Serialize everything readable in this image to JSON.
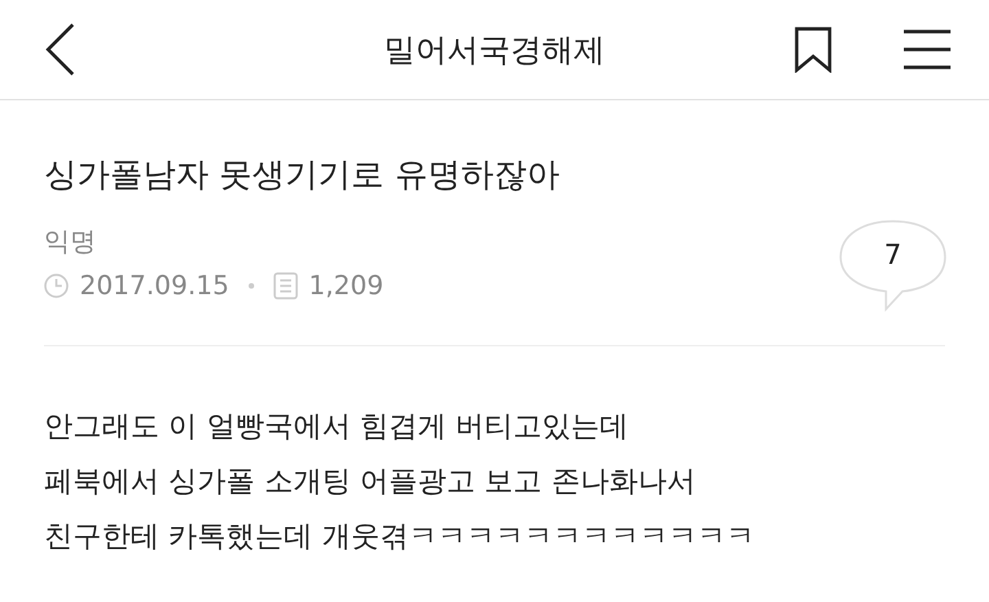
{
  "header": {
    "title": "밀어서국경해제"
  },
  "post": {
    "title": "싱가폴남자 못생기기로 유명하잖아",
    "author": "익명",
    "date": "2017.09.15",
    "views": "1,209",
    "comments": "7"
  },
  "body": [
    "안그래도 이 얼빵국에서 힘겹게 버티고있는데",
    "페북에서 싱가폴 소개팅 어플광고 보고 존나화나서",
    "친구한테 카톡했는데 개웃겪ㅋㅋㅋㅋㅋㅋㅋㅋㅋㅋㅋㅋ"
  ]
}
